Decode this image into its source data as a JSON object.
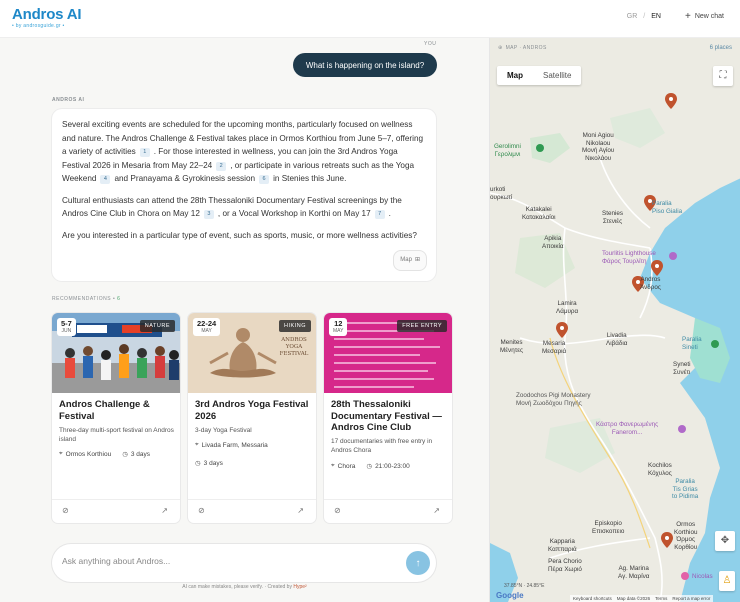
{
  "header": {
    "logo": "Andros AI",
    "logo_sub": "• by androsguide.gr •",
    "lang_gr": "GR",
    "lang_sep": "/",
    "lang_en": "EN",
    "new_chat": "New chat"
  },
  "chat": {
    "you_label": "YOU",
    "user_message": "What is happening on the island?",
    "ai_label": "ANDROS AI",
    "paragraphs": [
      {
        "parts": [
          "Several exciting events are scheduled for the upcoming months, particularly focused on wellness and nature. The Andros Challenge & Festival takes place in Ormos Korthiou from June 5–7, offering a variety of activities",
          "1",
          ". For those interested in wellness, you can join the 3rd Andros Yoga Festival 2026 in Mesaria from May 22–24",
          "2",
          ", or participate in various retreats such as the Yoga Weekend",
          "4",
          "and Pranayama & Gyrokinesis session",
          "6",
          "in Stenies this June."
        ]
      },
      {
        "parts": [
          "Cultural enthusiasts can attend the 28th Thessaloniki Documentary Festival screenings by the Andros Cine Club in Chora on May 12",
          "3",
          ", or a Vocal Workshop in Korthi on May 17",
          "7",
          "."
        ]
      },
      {
        "parts": [
          "Are you interested in a particular type of event, such as sports, music, or more wellness activities?"
        ]
      }
    ],
    "map_chip": "Map",
    "recommendations_label": "RECOMMENDATIONS",
    "recommendations_sep": "•",
    "recommendations_count": "6"
  },
  "cards": [
    {
      "date": "5-7",
      "month": "JUN",
      "tag": "NATURE",
      "title": "Andros Challenge & Festival",
      "desc": "Three-day multi-sport festival on Andros island",
      "location": "Ormos Korthiou",
      "duration": "3 days"
    },
    {
      "date": "22-24",
      "month": "MAY",
      "tag": "HIKING",
      "title": "3rd Andros Yoga Festival 2026",
      "desc": "3-day Yoga Festival",
      "location": "Livada Farm, Messaria",
      "duration": "3 days",
      "poster": "ANDROS YOGA FESTIVAL"
    },
    {
      "date": "12",
      "month": "MAY",
      "tag": "FREE ENTRY",
      "title": "28th Thessaloniki Documentary Festival — Andros Cine Club",
      "desc": "17 documentaries with free entry in Andros Chora",
      "location": "Chora",
      "time": "21:00-23:00"
    }
  ],
  "composer": {
    "placeholder": "Ask anything about Andros...",
    "send_icon": "↑"
  },
  "disclaimer": {
    "text": "AI can make mistakes, please verify. · Created by",
    "brand": "Hype²"
  },
  "map": {
    "title": "MAP · ANDROS",
    "places": "6 places",
    "type_map": "Map",
    "type_satellite": "Satellite",
    "coords": "37.85°N · 24.85°E",
    "google": "Google",
    "footer": [
      "Keyboard shortcuts",
      "Map data ©2026",
      "Terms",
      "Report a map error"
    ],
    "labels": [
      {
        "t1": "Gerolimni",
        "t2": "Γερολιμνι",
        "c": "g"
      },
      {
        "t1": "Moni Agiou",
        "t2": "Nikolaou",
        "t3": "Μονή Αγίου",
        "t4": "Νικολάου",
        "c": ""
      },
      {
        "t1": "urkoti",
        "t2": "ουρκωτί",
        "c": ""
      },
      {
        "t1": "Katakalei",
        "t2": "Κατακαλαίοι",
        "c": ""
      },
      {
        "t1": "Stenies",
        "t2": "Στενιές",
        "c": ""
      },
      {
        "t1": "Paralia",
        "t2": "Piso Gialia",
        "c": "t"
      },
      {
        "t1": "Apikia",
        "t2": "Αποικία",
        "c": ""
      },
      {
        "t1": "Tourlitis Lighthouse",
        "t2": "Φάρος Τουρλίτη",
        "c": "p"
      },
      {
        "t1": "Andros",
        "t2": "Άνδρος",
        "c": ""
      },
      {
        "t1": "Lamira",
        "t2": "Λάμυρα",
        "c": ""
      },
      {
        "t1": "Menites",
        "t2": "Μένητες",
        "c": ""
      },
      {
        "t1": "Mesaria",
        "t2": "Μεσαριά",
        "c": ""
      },
      {
        "t1": "Livadia",
        "t2": "Λιβάδια",
        "c": ""
      },
      {
        "t1": "Paralia",
        "t2": "Sineti",
        "c": "t"
      },
      {
        "t1": "Syneti",
        "t2": "Συνέτι",
        "c": ""
      },
      {
        "t1": "Zoodochos Pigi Monastery",
        "t2": "Μονή Ζωοδόχου Πηγής",
        "c": ""
      },
      {
        "t1": "Κάστρο Φανερωμένης",
        "t2": "Fanerom...",
        "c": "p"
      },
      {
        "t1": "Kochilos",
        "t2": "Κόχυλος",
        "c": ""
      },
      {
        "t1": "Paralia",
        "t2": "Tis Grias",
        "t3": "to Pidima",
        "c": "t"
      },
      {
        "t1": "Episkopio",
        "t2": "Επισκοπειο",
        "c": ""
      },
      {
        "t1": "Ormos",
        "t2": "Korthiou",
        "t3": "Όρμος",
        "t4": "Κορθίου",
        "c": ""
      },
      {
        "t1": "Kapparia",
        "t2": "Καππαριά",
        "c": ""
      },
      {
        "t1": "Pera Chorio",
        "t2": "Πέρα Χωριό",
        "c": ""
      },
      {
        "t1": "Ag. Marina",
        "t2": "Αγ. Μαρίνα",
        "c": ""
      },
      {
        "t1": "Nicolas",
        "c": "p"
      }
    ]
  },
  "colors": {
    "brand": "#1e88c8",
    "user_bubble": "#1f3a4c",
    "pin": "#c0532e",
    "sea": "#8fd0ea",
    "send": "#88c3e2"
  }
}
